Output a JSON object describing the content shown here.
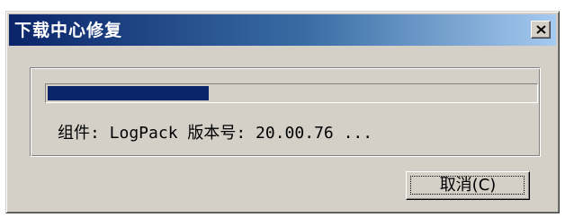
{
  "dialog": {
    "title": "下载中心修复",
    "close_icon": "close-icon",
    "progress_percent": 33,
    "progress_color": "#0a246a",
    "status_text": "组件: LogPack 版本号: 20.00.76 ...",
    "cancel_label": "取消(C)"
  }
}
